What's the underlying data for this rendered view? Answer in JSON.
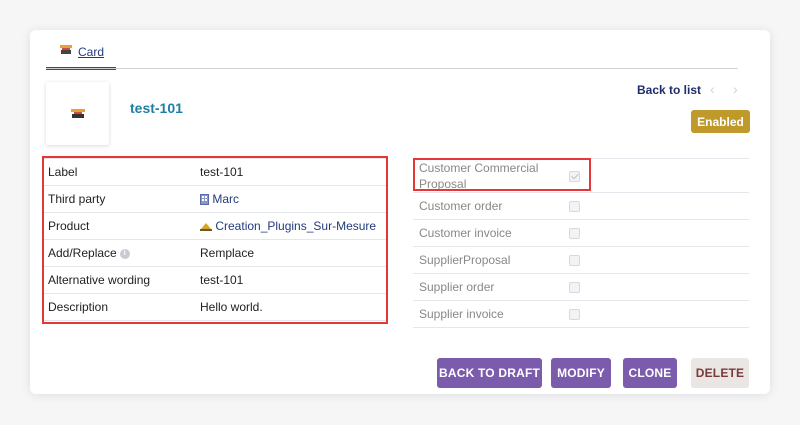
{
  "tabs": [
    {
      "label": "Card",
      "icon": "product-thumbnail-icon"
    }
  ],
  "header": {
    "ref": "test-101",
    "back_to_list": "Back to list",
    "prev_arrow": "‹",
    "next_arrow": "›",
    "status_badge": "Enabled",
    "status_color": "#bf9a2b"
  },
  "fields": {
    "label": {
      "key": "Label",
      "value": "test-101"
    },
    "third_party": {
      "key": "Third party",
      "value": "Marc",
      "icon": "company-icon"
    },
    "product": {
      "key": "Product",
      "value": "Creation_Plugins_Sur-Mesure",
      "icon": "product-service-icon"
    },
    "add_replace": {
      "key": "Add/Replace",
      "value": "Remplace",
      "info_icon": "info-icon"
    },
    "alternative_wording": {
      "key": "Alternative wording",
      "value": "test-101"
    },
    "description": {
      "key": "Description",
      "value": "Hello world."
    }
  },
  "usages": [
    {
      "label": "Customer Commercial Proposal",
      "checked": true
    },
    {
      "label": "Customer order",
      "checked": false
    },
    {
      "label": "Customer invoice",
      "checked": false
    },
    {
      "label": "SupplierProposal",
      "checked": false
    },
    {
      "label": "Supplier order",
      "checked": false
    },
    {
      "label": "Supplier invoice",
      "checked": false
    }
  ],
  "actions": {
    "back_to_draft": "BACK TO DRAFT",
    "modify": "MODIFY",
    "clone": "CLONE",
    "delete": "DELETE"
  },
  "colors": {
    "accent": "#7b5cac",
    "highlight": "#e5373a",
    "ref": "#1e7fa3"
  }
}
